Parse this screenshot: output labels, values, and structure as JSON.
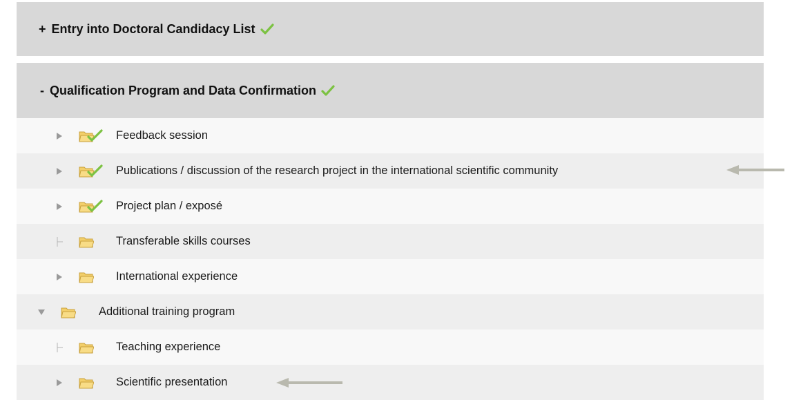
{
  "sections": [
    {
      "sign": "+",
      "title": "Entry into Doctoral Candidacy List",
      "completed": true,
      "expanded": false
    },
    {
      "sign": "-",
      "title": "Qualification Program and Data Confirmation",
      "completed": true,
      "expanded": true
    }
  ],
  "tree": [
    {
      "label": "Feedback session",
      "level": 1,
      "toggle": "collapsed",
      "completed": true
    },
    {
      "label": "Publications / discussion of the research project in the international scientific community",
      "level": 1,
      "toggle": "collapsed",
      "completed": true
    },
    {
      "label": "Project plan / exposé",
      "level": 1,
      "toggle": "collapsed",
      "completed": true
    },
    {
      "label": "Transferable skills courses",
      "level": 1,
      "toggle": "leaf",
      "completed": false
    },
    {
      "label": "International experience",
      "level": 1,
      "toggle": "collapsed",
      "completed": false
    },
    {
      "label": "Additional training program",
      "level": 0,
      "toggle": "expanded",
      "completed": false
    },
    {
      "label": "Teaching experience",
      "level": 1,
      "toggle": "leaf",
      "completed": false
    },
    {
      "label": "Scientific presentation",
      "level": 1,
      "toggle": "collapsed",
      "completed": false
    }
  ],
  "colors": {
    "header_bg": "#d8d8d8",
    "row_odd": "#f8f8f8",
    "row_even": "#eeeeee",
    "check_green": "#7cc242",
    "folder_yellow": "#f3cf6a",
    "annotation_arrow": "#b9b9ae"
  },
  "icons": {
    "check": "check-icon",
    "folder": "folder-icon",
    "folder_check": "folder-check-icon",
    "expand": "triangle-right-icon",
    "collapse": "triangle-down-icon",
    "leaf": "tree-branch-icon",
    "annotation": "annotation-arrow-icon"
  }
}
